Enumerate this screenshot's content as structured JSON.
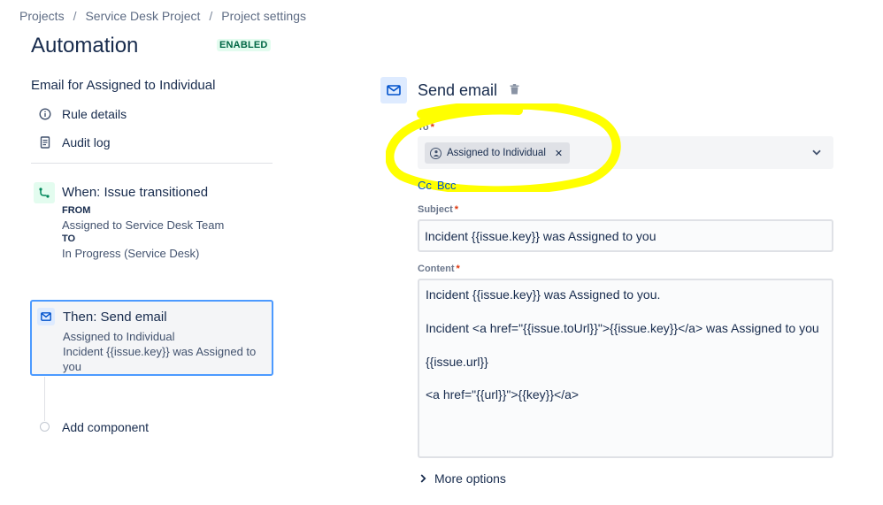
{
  "breadcrumb": {
    "items": [
      "Projects",
      "Service Desk Project",
      "Project settings"
    ],
    "separator": "/"
  },
  "page": {
    "title": "Automation",
    "status": "ENABLED"
  },
  "rule": {
    "name": "Email for Assigned to Individual"
  },
  "sidebar": {
    "links": [
      {
        "label": "Rule details",
        "icon": "info-icon"
      },
      {
        "label": "Audit log",
        "icon": "document-icon"
      }
    ]
  },
  "trigger": {
    "title": "When: Issue transitioned",
    "from_label": "FROM",
    "from_value": "Assigned to Service Desk Team",
    "to_label": "TO",
    "to_value": "In Progress (Service Desk)"
  },
  "action": {
    "title": "Then: Send email",
    "line1": "Assigned to Individual",
    "line2": "Incident {{issue.key}} was Assigned to you"
  },
  "add_component": "Add component",
  "editor": {
    "title": "Send email",
    "to_label": "To",
    "to_chip": "Assigned to Individual",
    "cc_label": "Cc",
    "bcc_label": "Bcc",
    "subject_label": "Subject",
    "subject_value": "Incident {{issue.key}} was Assigned to you",
    "content_label": "Content",
    "content_lines": [
      "Incident {{issue.key}} was Assigned to you.",
      "Incident <a href=\"{{issue.toUrl}}\">{{issue.key}}</a> was Assigned to you",
      "{{issue.url}}",
      "<a href=\"{{url}}\">{{key}}</a>"
    ],
    "more_options": "More options"
  },
  "colors": {
    "accent": "#0052cc",
    "highlight": "#ffff00",
    "enabled_text": "#006644",
    "enabled_bg": "#e3fcef"
  }
}
